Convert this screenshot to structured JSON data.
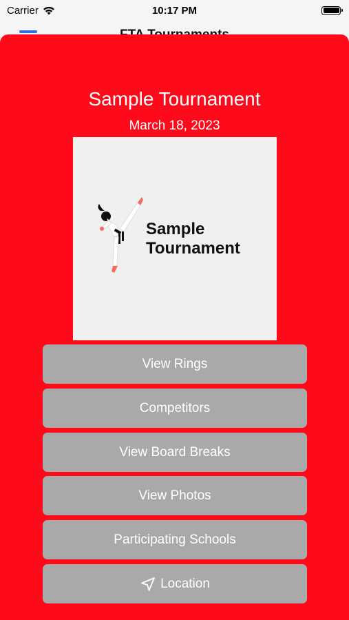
{
  "status_bar": {
    "carrier": "Carrier",
    "time": "10:17 PM"
  },
  "nav": {
    "title": "FTA Tournaments"
  },
  "tournament": {
    "title": "Sample Tournament",
    "date": "March 18, 2023",
    "logo_text_line1": "Sample",
    "logo_text_line2": "Tournament"
  },
  "buttons": {
    "rings": "View Rings",
    "competitors": "Competitors",
    "board_breaks": "View Board Breaks",
    "photos": "View Photos",
    "schools": "Participating Schools",
    "location": "Location"
  },
  "colors": {
    "sheet_background": "#ff0a1b",
    "button_background": "#a9a9a9",
    "accent": "#2f6fe0"
  },
  "icons": {
    "location": "location-arrow-icon",
    "wifi": "wifi-icon",
    "battery": "battery-icon",
    "menu": "menu-icon"
  }
}
